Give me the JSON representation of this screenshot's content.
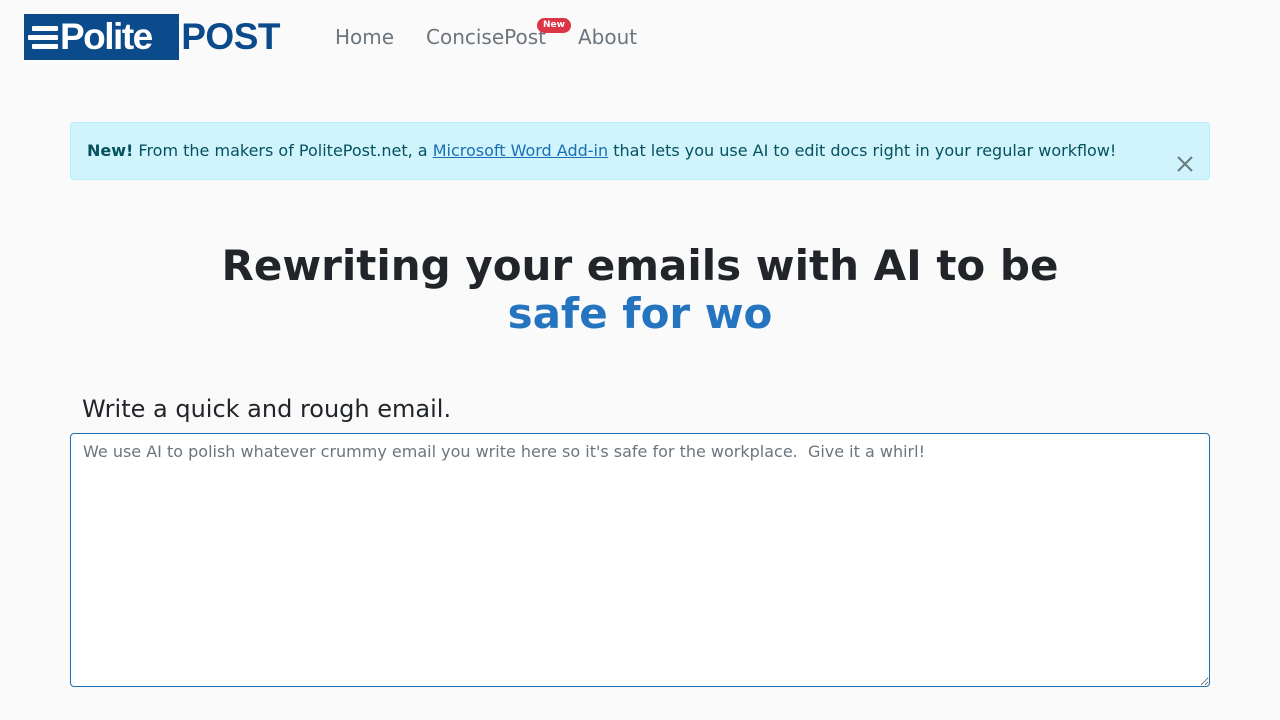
{
  "brand": {
    "polite": "Polite",
    "post": "POST"
  },
  "nav": {
    "home": "Home",
    "concisepost": "ConcisePost",
    "concisepost_badge": "New",
    "about": "About"
  },
  "alert": {
    "bold": "New!",
    "text_before": " From the makers of PolitePost.net, a ",
    "link": "Microsoft Word Add-in",
    "text_after": " that lets you use AI to edit docs right in your regular workflow!"
  },
  "hero": {
    "line1": "Rewriting your emails with AI to be",
    "line2": "safe for wo"
  },
  "form": {
    "label": "Write a quick and rough email.",
    "placeholder": "We use AI to polish whatever crummy email you write here so it's safe for the workplace.  Give it a whirl!"
  },
  "colors": {
    "brand": "#0b4a8b",
    "accent": "#2574c0",
    "badge": "#dc3545",
    "alert_bg": "#cff4fc"
  }
}
